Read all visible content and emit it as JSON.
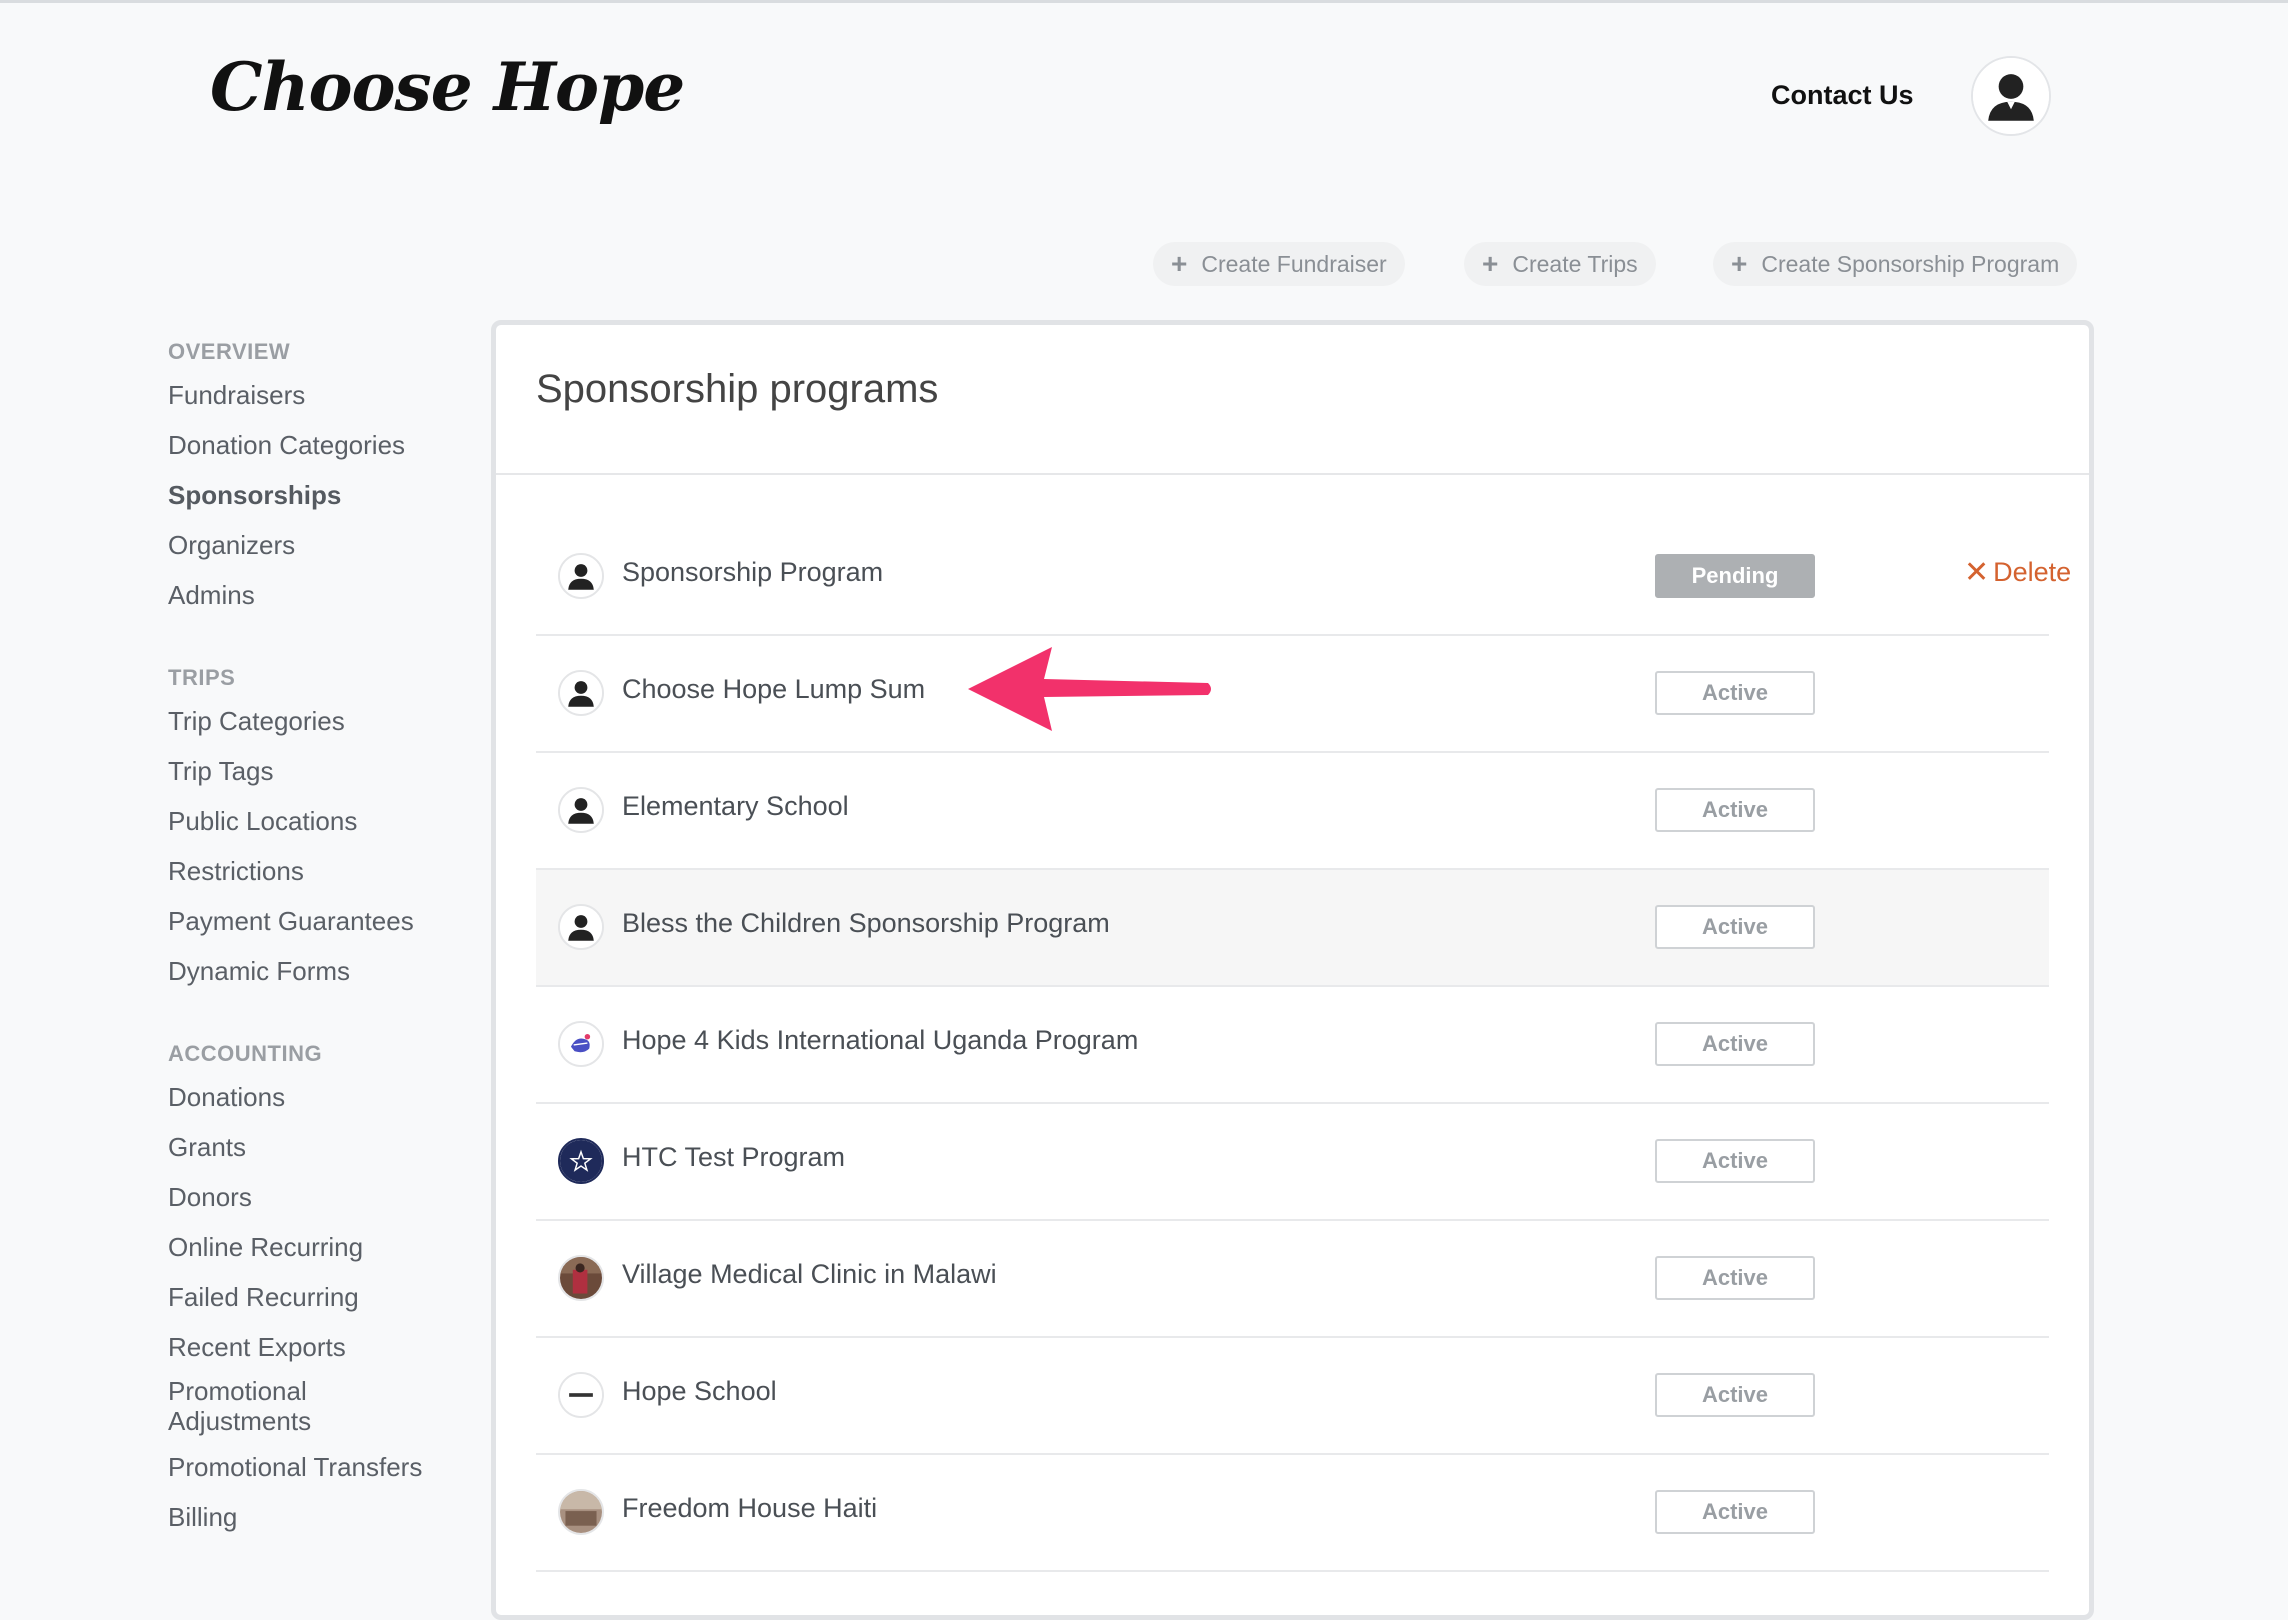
{
  "brand": {
    "logo_text": "Choose Hope"
  },
  "header": {
    "contact_label": "Contact Us",
    "avatar_icon": "user-silhouette-icon"
  },
  "actions": [
    {
      "label": "Create Fundraiser",
      "icon": "plus-icon"
    },
    {
      "label": "Create Trips",
      "icon": "plus-icon"
    },
    {
      "label": "Create Sponsorship Program",
      "icon": "plus-icon"
    }
  ],
  "sidebar": {
    "sections": [
      {
        "title": "OVERVIEW",
        "items": [
          "Fundraisers",
          "Donation Categories",
          "Sponsorships",
          "Organizers",
          "Admins"
        ]
      },
      {
        "title": "TRIPS",
        "items": [
          "Trip Categories",
          "Trip Tags",
          "Public Locations",
          "Restrictions",
          "Payment Guarantees",
          "Dynamic Forms"
        ]
      },
      {
        "title": "ACCOUNTING",
        "items": [
          "Donations",
          "Grants",
          "Donors",
          "Online Recurring",
          "Failed Recurring",
          "Recent Exports",
          "Promotional Adjustments",
          "Promotional Transfers",
          "Billing"
        ]
      }
    ],
    "active_item": "Sponsorships"
  },
  "main": {
    "title": "Sponsorship programs",
    "programs": [
      {
        "name": "Sponsorship Program",
        "status": "Pending",
        "action": "Delete",
        "avatar": "user-silhouette-icon"
      },
      {
        "name": "Choose Hope Lump Sum",
        "status": "Active",
        "avatar": "user-silhouette-icon"
      },
      {
        "name": "Elementary School",
        "status": "Active",
        "avatar": "user-silhouette-icon"
      },
      {
        "name": "Bless the Children Sponsorship Program",
        "status": "Active",
        "avatar": "user-silhouette-icon"
      },
      {
        "name": "Hope 4 Kids International Uganda Program",
        "status": "Active",
        "avatar": "hope4kids-logo-icon"
      },
      {
        "name": "HTC Test Program",
        "status": "Active",
        "avatar": "star-logo-icon"
      },
      {
        "name": "Village Medical Clinic in Malawi",
        "status": "Active",
        "avatar": "photo-thumbnail-icon"
      },
      {
        "name": "Hope School",
        "status": "Active",
        "avatar": "school-logo-icon"
      },
      {
        "name": "Freedom House Haiti",
        "status": "Active",
        "avatar": "photo-thumbnail-icon"
      }
    ],
    "highlighted_row": "Bless the Children Sponsorship Program"
  },
  "annotation": {
    "arrow_color": "#f2316b",
    "points_to": "Choose Hope Lump Sum"
  },
  "colors": {
    "delete": "#d4622f",
    "pending_badge": "#adb0b3"
  }
}
